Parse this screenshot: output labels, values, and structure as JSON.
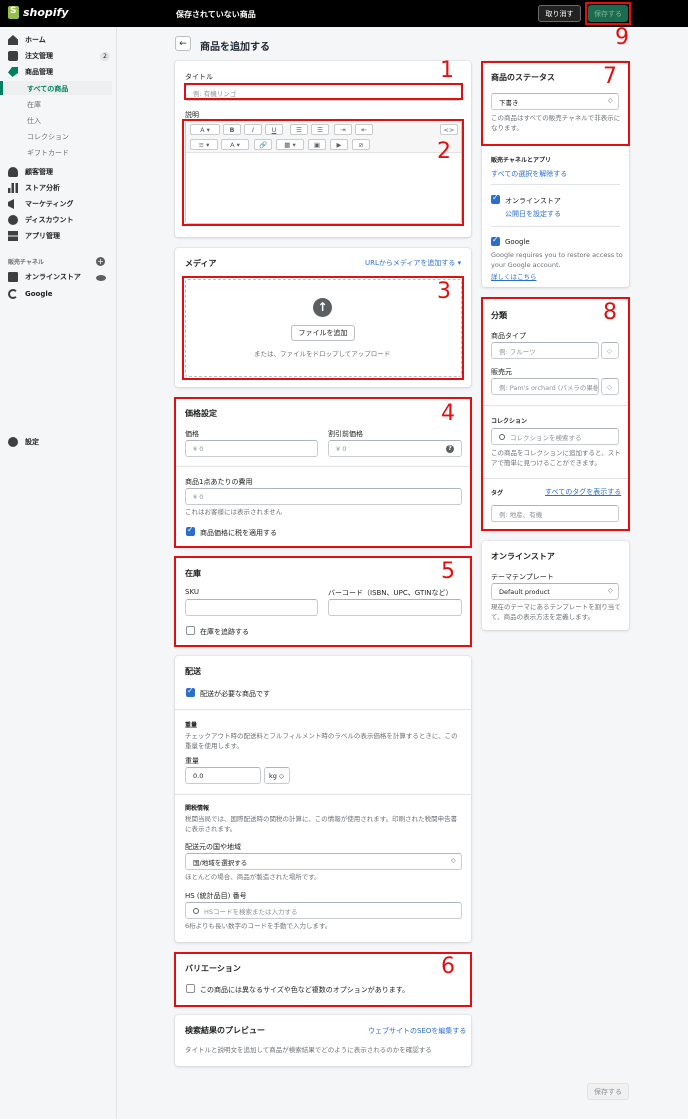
{
  "topbar": {
    "logo_text": "shopify",
    "unsaved_title": "保存されていない商品",
    "discard_label": "取り消す",
    "save_label": "保存する"
  },
  "sidebar": {
    "home": "ホーム",
    "orders": "注文管理",
    "orders_badge": "2",
    "products": "商品管理",
    "sub_items": [
      "すべての商品",
      "在庫",
      "仕入",
      "コレクション",
      "ギフトカード"
    ],
    "customers": "顧客管理",
    "analytics": "ストア分析",
    "marketing": "マーケティング",
    "discounts": "ディスカウント",
    "apps": "アプリ管理",
    "sales_channels_label": "販売チャネル",
    "online_store": "オンラインストア",
    "google": "Google",
    "settings": "設定"
  },
  "page": {
    "title": "商品を追加する",
    "back_icon": "←"
  },
  "title_card": {
    "title_label": "タイトル",
    "title_placeholder": "例: 有機リンゴ",
    "description_label": "説明",
    "toolbar_row1": [
      "A ▾",
      "B",
      "I",
      "U",
      "☰",
      "☰",
      "⇥",
      "⇤",
      "<>"
    ],
    "toolbar_row2": [
      "≡ ▾",
      "A ▾",
      "🔗",
      "▦ ▾",
      "▣",
      "▶",
      "⊘"
    ]
  },
  "media": {
    "heading": "メディア",
    "url_link": "URLからメディアを追加する ▾",
    "add_file": "ファイルを追加",
    "drop_hint": "または、ファイルをドロップしてアップロード"
  },
  "pricing": {
    "heading": "価格設定",
    "price_label": "価格",
    "price_value": "¥  0",
    "compare_label": "割引前価格",
    "compare_value": "¥  0",
    "cost_label": "商品1点あたりの費用",
    "cost_value": "¥  0",
    "cost_help": "これはお客様には表示されません",
    "tax_label": "商品価格に税を適用する"
  },
  "inventory": {
    "heading": "在庫",
    "sku_label": "SKU",
    "barcode_label": "バーコード（ISBN、UPC、GTINなど）",
    "track_label": "在庫を追跡する"
  },
  "shipping": {
    "heading": "配送",
    "physical_label": "配送が必要な商品です",
    "weight_heading": "重量",
    "weight_help": "チェックアウト時の配送料とフルフィルメント時のラベルの表示価格を計算するときに、この重量を使用します。",
    "weight_label": "重量",
    "weight_value": "0.0",
    "unit": "kg ◇",
    "customs_heading": "関税情報",
    "customs_help": "税関当局では、国際配送時の関税の計算に、この情報が使用されます。印刷された税関申告書に表示されます。",
    "country_label": "配送元の国や地域",
    "country_value": "国/地域を選択する",
    "country_help": "ほとんどの場合、商品が製造された場所です。",
    "hs_label": "HS (統計品目) 番号",
    "hs_placeholder": "HSコードを検索または入力する",
    "hs_help": "6桁よりも長い数字のコードを手動で入力します。"
  },
  "variants": {
    "heading": "バリエーション",
    "option_label": "この商品には異なるサイズや色など複数のオプションがあります。"
  },
  "seo": {
    "heading": "検索結果のプレビュー",
    "edit_link": "ウェブサイトのSEOを編集する",
    "description": "タイトルと説明文を追加して商品が検索結果でどのように表示されるのかを確認する"
  },
  "status": {
    "heading": "商品のステータス",
    "value": "下書き",
    "help": "この商品はすべての販売チャネルで非表示になります。"
  },
  "channels": {
    "heading": "販売チャネルとアプリ",
    "deselect_link": "すべての選択を解除する",
    "online_store": "オンラインストア",
    "publish_date_link": "公開日を設定する",
    "google": "Google",
    "google_help": "Google requires you to restore access to your Google account.",
    "learn_more": "詳しくはこちら"
  },
  "organization": {
    "heading": "分類",
    "type_label": "商品タイプ",
    "type_placeholder": "例: フルーツ",
    "vendor_label": "販売元",
    "vendor_placeholder": "例: Pam's orchard (パメラの果樹",
    "collections_label": "コレクション",
    "collections_placeholder": "コレクションを検索する",
    "collections_help": "この商品をコレクションに追加すると、ストアで簡単に見つけることができます。",
    "tags_label": "タグ",
    "tags_link": "すべてのタグを表示する",
    "tags_placeholder": "例: 地産、有機"
  },
  "online_store_card": {
    "heading": "オンラインストア",
    "template_label": "テーマテンプレート",
    "template_value": "Default product",
    "template_help": "現在のテーマにあるテンプレートを割り当てて、商品の表示方法を定義します。"
  },
  "bottom": {
    "save_label": "保存する"
  },
  "annotations": [
    "1",
    "2",
    "3",
    "4",
    "5",
    "6",
    "7",
    "8",
    "9"
  ],
  "colors": {
    "accent": "#008060",
    "annotation": "#e01010",
    "link": "#2c6ecb",
    "topbar": "#000000"
  }
}
